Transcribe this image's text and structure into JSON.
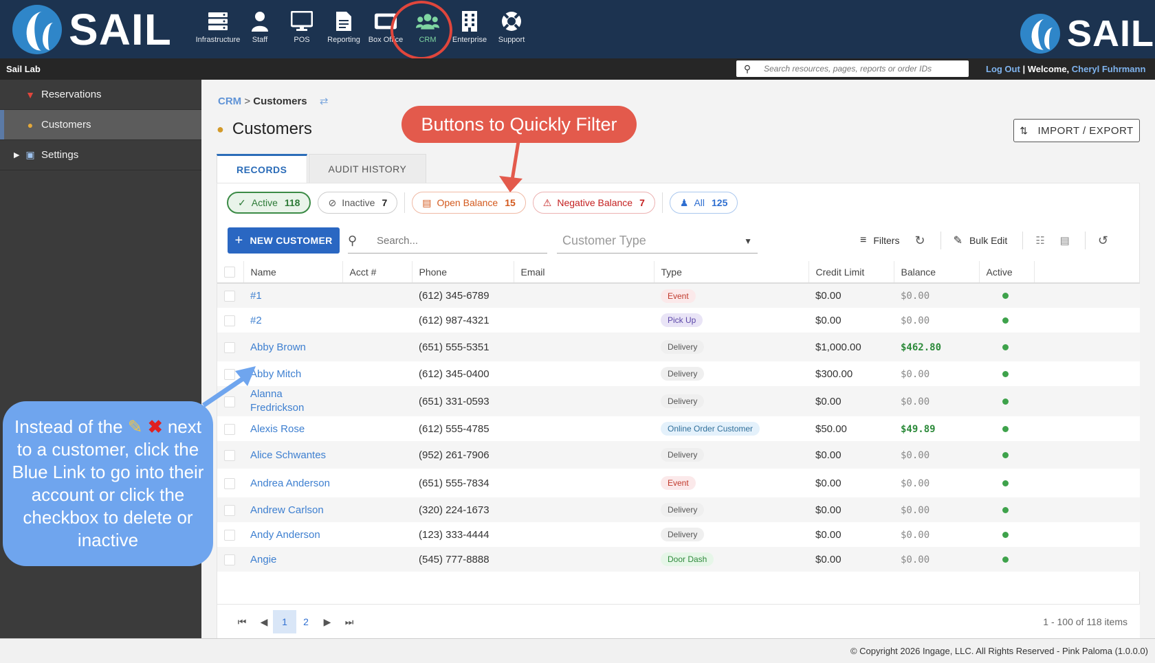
{
  "brand": {
    "name": "SAIL"
  },
  "nav": [
    {
      "label": "Infrastructure",
      "icon": "server-icon"
    },
    {
      "label": "Staff",
      "icon": "person-icon"
    },
    {
      "label": "POS",
      "icon": "monitor-icon"
    },
    {
      "label": "Reporting",
      "icon": "document-icon"
    },
    {
      "label": "Box Office",
      "icon": "ticket-icon"
    },
    {
      "label": "CRM",
      "icon": "people-icon"
    },
    {
      "label": "Enterprise",
      "icon": "building-icon"
    },
    {
      "label": "Support",
      "icon": "lifebuoy-icon"
    }
  ],
  "subbar": {
    "org": "Sail Lab",
    "search_placeholder": "Search resources, pages, reports or order IDs",
    "logout": "Log Out",
    "sep": "|",
    "welcome": "Welcome,",
    "user": "Cheryl Fuhrmann"
  },
  "sidebar": [
    {
      "label": "Reservations",
      "icon": "tie-icon"
    },
    {
      "label": "Customers",
      "icon": "customer-icon"
    },
    {
      "label": "Settings",
      "icon": "chart-icon"
    }
  ],
  "breadcrumb": {
    "root": "CRM",
    "sep": ">",
    "current": "Customers"
  },
  "page": {
    "title": "Customers",
    "import_export": "IMPORT / EXPORT"
  },
  "tabs": [
    "RECORDS",
    "AUDIT HISTORY"
  ],
  "chips": {
    "active": {
      "label": "Active",
      "count": "118"
    },
    "inactive": {
      "label": "Inactive",
      "count": "7"
    },
    "open": {
      "label": "Open Balance",
      "count": "15"
    },
    "negative": {
      "label": "Negative Balance",
      "count": "7"
    },
    "all": {
      "label": "All",
      "count": "125"
    }
  },
  "toolbar": {
    "new_customer": "NEW CUSTOMER",
    "search_placeholder": "Search...",
    "customer_type": "Customer Type",
    "filters": "Filters",
    "bulk_edit": "Bulk Edit"
  },
  "table": {
    "columns": [
      "Name",
      "Acct #",
      "Phone",
      "Email",
      "Type",
      "Credit Limit",
      "Balance",
      "Active"
    ],
    "rows": [
      {
        "name": "#1",
        "phone": "(612) 345-6789",
        "type": "Event",
        "type_class": "event",
        "credit": "$0.00",
        "balance": "$0.00",
        "pos": false
      },
      {
        "name": "#2",
        "phone": "(612) 987-4321",
        "type": "Pick Up",
        "type_class": "pickup",
        "credit": "$0.00",
        "balance": "$0.00",
        "pos": false
      },
      {
        "name": "Abby Brown",
        "phone": "(651) 555-5351",
        "type": "Delivery",
        "type_class": "delivery",
        "credit": "$1,000.00",
        "balance": "$462.80",
        "pos": true
      },
      {
        "name": "Abby Mitch",
        "phone": "(612) 345-0400",
        "type": "Delivery",
        "type_class": "delivery",
        "credit": "$300.00",
        "balance": "$0.00",
        "pos": false
      },
      {
        "name": "Alanna Fredrickson",
        "phone": "(651) 331-0593",
        "type": "Delivery",
        "type_class": "delivery",
        "credit": "$0.00",
        "balance": "$0.00",
        "pos": false
      },
      {
        "name": "Alexis Rose",
        "phone": "(612) 555-4785",
        "type": "Online Order Customer",
        "type_class": "online",
        "credit": "$50.00",
        "balance": "$49.89",
        "pos": true
      },
      {
        "name": "Alice Schwantes",
        "phone": "(952) 261-7906",
        "type": "Delivery",
        "type_class": "delivery",
        "credit": "$0.00",
        "balance": "$0.00",
        "pos": false
      },
      {
        "name": "Andrea Anderson",
        "phone": "(651) 555-7834",
        "type": "Event",
        "type_class": "event",
        "credit": "$0.00",
        "balance": "$0.00",
        "pos": false
      },
      {
        "name": "Andrew Carlson",
        "phone": "(320) 224-1673",
        "type": "Delivery",
        "type_class": "delivery",
        "credit": "$0.00",
        "balance": "$0.00",
        "pos": false
      },
      {
        "name": "Andy Anderson",
        "phone": "(123) 333-4444",
        "type": "Delivery",
        "type_class": "delivery",
        "credit": "$0.00",
        "balance": "$0.00",
        "pos": false
      },
      {
        "name": "Angie",
        "phone": "(545) 777-8888",
        "type": "Door Dash",
        "type_class": "dash",
        "credit": "$0.00",
        "balance": "$0.00",
        "pos": false
      }
    ]
  },
  "pager": {
    "page1": "1",
    "page2": "2",
    "info": "1 - 100 of 118 items"
  },
  "footer": {
    "copyright": "© Copyright 2026 Ingage, LLC. All Rights Reserved - Pink Paloma (1.0.0.0)"
  },
  "annotations": {
    "top": "Buttons to Quickly Filter",
    "left_line1": "Instead of the",
    "left_rest": "next to a customer, click the Blue Link to go into their account or click the checkbox to delete or inactive"
  }
}
